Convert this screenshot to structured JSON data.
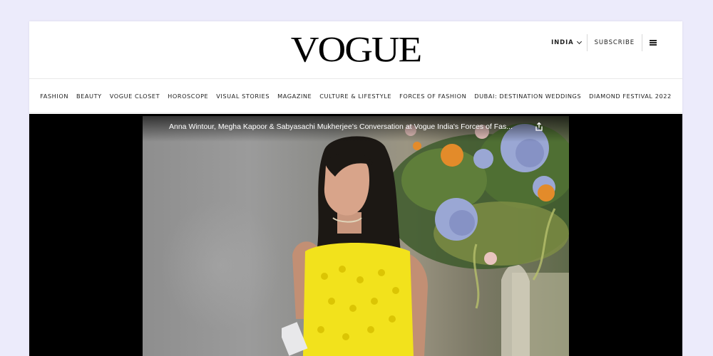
{
  "brand": {
    "logo_text": "VOGUE"
  },
  "header": {
    "edition_label": "INDIA",
    "subscribe_label": "SUBSCRIBE",
    "menu_icon": "hamburger-menu-icon"
  },
  "nav": {
    "items": [
      {
        "label": "FASHION"
      },
      {
        "label": "BEAUTY"
      },
      {
        "label": "VOGUE CLOSET"
      },
      {
        "label": "HOROSCOPE"
      },
      {
        "label": "VISUAL STORIES"
      },
      {
        "label": "MAGAZINE"
      },
      {
        "label": "CULTURE & LIFESTYLE"
      },
      {
        "label": "FORCES OF FASHION"
      },
      {
        "label": "DUBAI: DESTINATION WEDDINGS"
      },
      {
        "label": "DIAMOND FESTIVAL 2022"
      }
    ]
  },
  "video": {
    "title": "Anna Wintour, Megha Kapoor & Sabyasachi Mukherjee's Conversation at Vogue India's Forces of Fas...",
    "share_icon": "share-icon"
  },
  "colors": {
    "page_background": "#ecebfb",
    "player_background": "#000000",
    "dress_yellow": "#f2e21c"
  }
}
